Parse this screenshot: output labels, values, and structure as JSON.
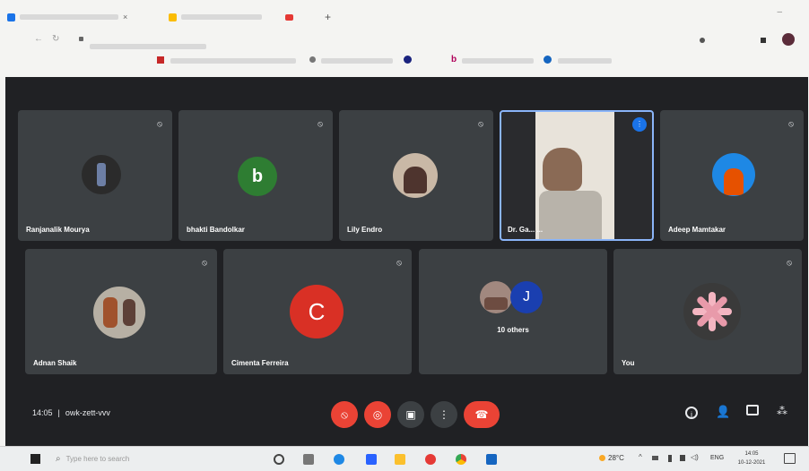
{
  "meeting": {
    "tiles": [
      {
        "name": "Ranjanalik Mourya",
        "avatar_type": "photo",
        "avatar_color": "#2b2b2b"
      },
      {
        "name": "bhakti Bandolkar",
        "avatar_type": "letter",
        "avatar_letter": "b",
        "avatar_color": "#2e7d32"
      },
      {
        "name": "Lily Endro",
        "avatar_type": "photo",
        "avatar_color": "#c9b8a6"
      },
      {
        "name": "Dr. Ga... ...",
        "avatar_type": "video",
        "avatar_color": "#d8d2c7"
      },
      {
        "name": "Adeep Mamtakar",
        "avatar_type": "photo",
        "avatar_color": "#1e88e5"
      },
      {
        "name": "Adnan Shaik",
        "avatar_type": "photo",
        "avatar_color": "#b7b0a4"
      },
      {
        "name": "Cimenta Ferreira",
        "avatar_type": "letter",
        "avatar_letter": "C",
        "avatar_color": "#d93025"
      },
      {
        "name": "10 others",
        "avatar_type": "group",
        "avatar_letter": "J",
        "avatar_color": "#1a3fb0"
      },
      {
        "name": "You",
        "avatar_type": "flower",
        "avatar_color": "#3a3a3a"
      }
    ],
    "time_code": "14:05",
    "meeting_code": "owk-zett-vvv",
    "separator": "|"
  },
  "taskbar": {
    "search_placeholder": "Type here to search",
    "temperature": "28°C",
    "language": "ENG",
    "clock_time": "14:05",
    "clock_date": "10-12-2021"
  },
  "colors": {
    "meet_bg": "#202124",
    "tile_bg": "#3c4043",
    "end_call": "#ea4335",
    "active_border": "#8ab4f8"
  }
}
